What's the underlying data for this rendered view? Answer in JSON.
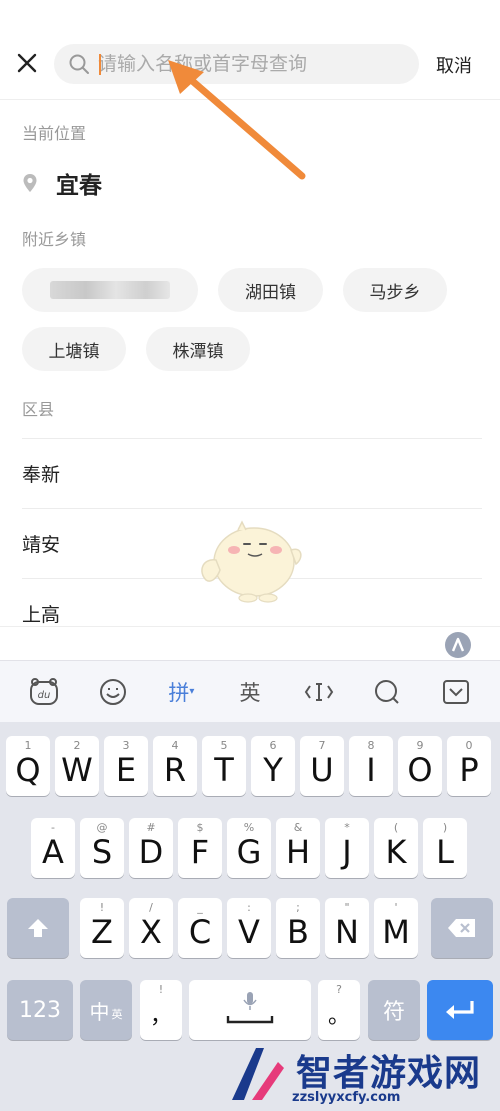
{
  "search": {
    "placeholder": "请输入名称或首字母查询",
    "cancel_label": "取消"
  },
  "current_location": {
    "section_label": "当前位置",
    "city": "宜春"
  },
  "nearby": {
    "section_label": "附近乡镇",
    "chips": [
      "",
      "湖田镇",
      "马步乡",
      "上塘镇",
      "株潭镇"
    ]
  },
  "districts": {
    "section_label": "区县",
    "items": [
      "奉新",
      "靖安",
      "上高"
    ]
  },
  "keyboard": {
    "toolbar": [
      "du",
      "emoji",
      "拼",
      "英",
      "cursor",
      "search",
      "collapse"
    ],
    "row1": [
      [
        "1",
        "Q"
      ],
      [
        "2",
        "W"
      ],
      [
        "3",
        "E"
      ],
      [
        "4",
        "R"
      ],
      [
        "5",
        "T"
      ],
      [
        "6",
        "Y"
      ],
      [
        "7",
        "U"
      ],
      [
        "8",
        "I"
      ],
      [
        "9",
        "O"
      ],
      [
        "0",
        "P"
      ]
    ],
    "row2": [
      [
        "-",
        "A"
      ],
      [
        "@",
        "S"
      ],
      [
        "#",
        "D"
      ],
      [
        "$",
        "F"
      ],
      [
        "%",
        "G"
      ],
      [
        "&",
        "H"
      ],
      [
        "*",
        "J"
      ],
      [
        "(",
        "K"
      ],
      [
        ")",
        "L"
      ]
    ],
    "row3": [
      [
        "!",
        "Z"
      ],
      [
        "/",
        "X"
      ],
      [
        "_",
        "C"
      ],
      [
        ":",
        "V"
      ],
      [
        ";",
        "B"
      ],
      [
        "\"",
        "N"
      ],
      [
        "'",
        "M"
      ]
    ],
    "num_label": "123",
    "zh_label": "中",
    "zh_sub": "英",
    "comma_sub": "!",
    "comma": "，",
    "period_sub": "?",
    "period": "。",
    "symbol_label": "符"
  },
  "watermark": {
    "brand": "智者游戏网",
    "url": "zzslyyxcfy.com"
  },
  "colors": {
    "accent": "#3c88f0",
    "arrow": "#f08a3a"
  }
}
